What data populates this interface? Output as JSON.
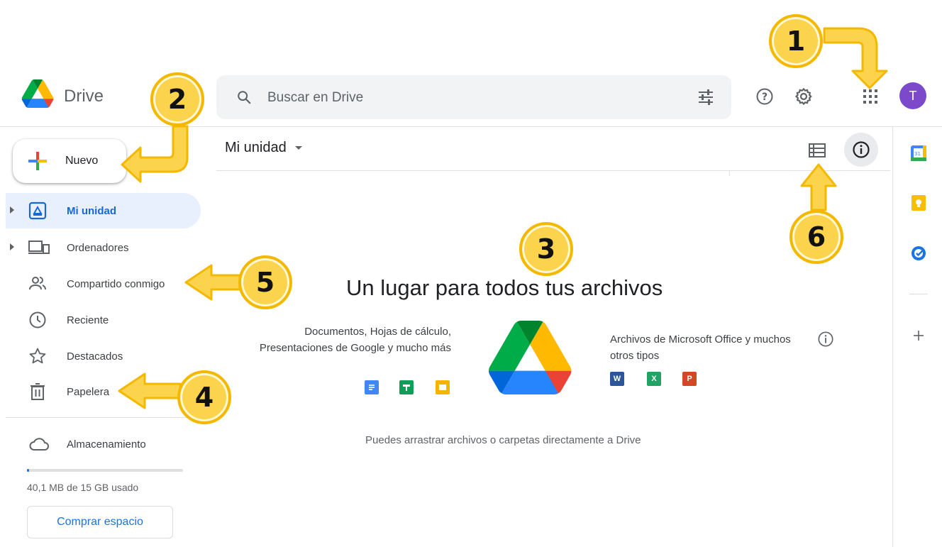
{
  "header": {
    "brand": "Drive",
    "search_placeholder": "Buscar en Drive",
    "avatar_initial": "T"
  },
  "sidebar": {
    "new_label": "Nuevo",
    "items": [
      {
        "label": "Mi unidad",
        "icon": "my-drive-icon",
        "active": true
      },
      {
        "label": "Ordenadores",
        "icon": "computers-icon"
      },
      {
        "label": "Compartido conmigo",
        "icon": "shared-icon"
      },
      {
        "label": "Reciente",
        "icon": "clock-icon"
      },
      {
        "label": "Destacados",
        "icon": "star-icon"
      },
      {
        "label": "Papelera",
        "icon": "trash-icon"
      }
    ],
    "storage_label": "Almacenamiento",
    "storage_used_text": "40,1 MB de 15 GB usado",
    "storage_used_fraction": 0.003,
    "buy_label": "Comprar espacio"
  },
  "main": {
    "breadcrumb": "Mi unidad",
    "empty_title": "Un lugar para todos tus archivos",
    "left_text": "Documentos, Hojas de cálculo, Presentaciones de Google y mucho más",
    "right_text": "Archivos de Microsoft Office y muchos otros tipos",
    "office_icons": [
      "W",
      "X",
      "P"
    ],
    "drag_hint": "Puedes arrastrar archivos o carpetas directamente a Drive"
  },
  "callouts": [
    "1",
    "2",
    "3",
    "4",
    "5",
    "6"
  ],
  "colors": {
    "accent": "#1a73e8",
    "active_bg": "#e8f0fe",
    "callout_fill": "#fcd34d",
    "callout_border": "#f5b800"
  }
}
